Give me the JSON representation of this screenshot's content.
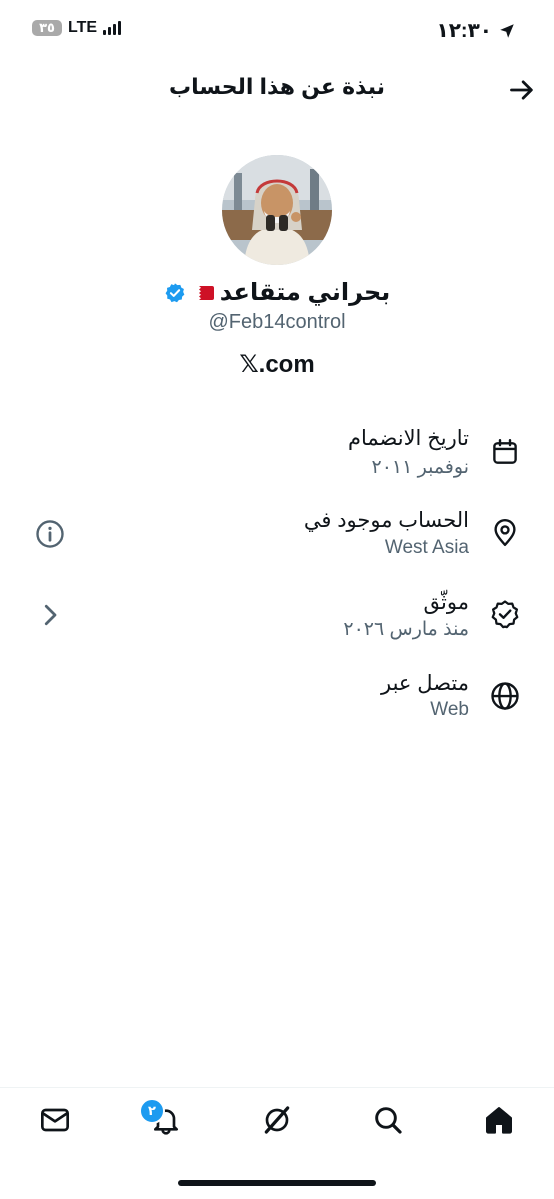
{
  "status_bar": {
    "time": "١٢:٣٠",
    "network": "LTE",
    "battery": "٣٥"
  },
  "header": {
    "title": "نبذة عن هذا الحساب"
  },
  "profile": {
    "name": "بحراني متقاعد",
    "handle": "@Feb14control",
    "website": "𝕏.com"
  },
  "info_rows": [
    {
      "label": "تاريخ الانضمام",
      "value": "نوفمبر ٢٠١١",
      "icon": "calendar-icon"
    },
    {
      "label": "الحساب موجود في",
      "value": "West Asia",
      "icon": "location-pin-icon"
    },
    {
      "label": "موثّق",
      "value": "منذ مارس ٢٠٢٦",
      "icon": "verified-badge-icon"
    },
    {
      "label": "متصل عبر",
      "value": "Web",
      "icon": "globe-icon"
    }
  ],
  "tabs": {
    "notifications_badge": "٢",
    "items": [
      "home-icon",
      "search-icon",
      "grok-icon",
      "notifications-icon",
      "messages-icon"
    ]
  },
  "colors": {
    "text": "#0f1419",
    "secondary": "#536471",
    "accent": "#1d9bf0"
  }
}
